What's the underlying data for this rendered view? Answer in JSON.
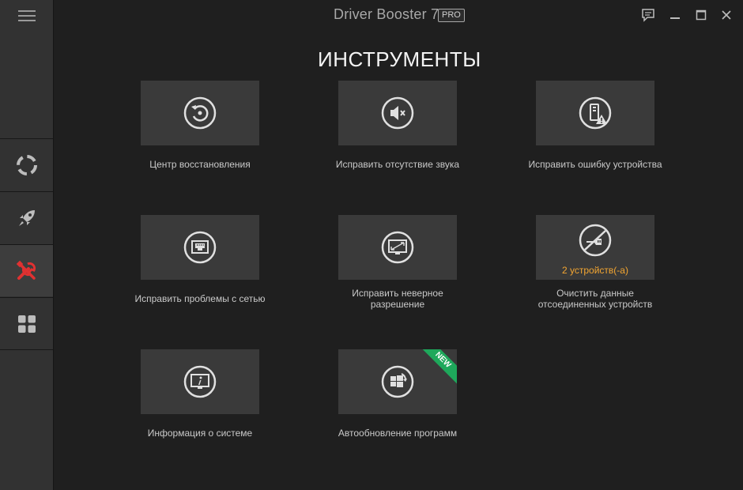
{
  "app": {
    "title": "Driver Booster 7",
    "edition_badge": "PRO"
  },
  "sidebar": {
    "menu_icon": "hamburger-icon",
    "items": [
      {
        "id": "scan",
        "icon": "lifebuoy-icon",
        "active": false
      },
      {
        "id": "boost",
        "icon": "rocket-icon",
        "active": false
      },
      {
        "id": "tools",
        "icon": "tools-icon",
        "active": true
      },
      {
        "id": "action-center",
        "icon": "grid-icon",
        "active": false
      }
    ]
  },
  "window_controls": [
    "feedback-icon",
    "minimize-icon",
    "maximize-icon",
    "close-icon"
  ],
  "page": {
    "title": "ИНСТРУМЕНТЫ"
  },
  "tools": [
    {
      "label": "Центр восстановления",
      "icon": "restore-icon"
    },
    {
      "label": "Исправить отсутствие звука",
      "icon": "mute-speaker-icon"
    },
    {
      "label": "Исправить ошибку устройства",
      "icon": "device-warning-icon"
    },
    {
      "label": "Исправить проблемы с сетью",
      "icon": "network-port-icon"
    },
    {
      "label_line1": "Исправить неверное",
      "label_line2": "разрешение",
      "icon": "resolution-icon"
    },
    {
      "label_line1": "Очистить данные",
      "label_line2": "отсоединенных устройств",
      "count": "2 устройств(-а)",
      "icon": "disconnected-device-icon"
    },
    {
      "label": "Информация о системе",
      "icon": "system-info-icon"
    },
    {
      "label": "Автообновление программ",
      "icon": "windows-update-icon",
      "badge": "NEW"
    }
  ],
  "colors": {
    "background": "#1f1f1f",
    "sidebar": "#323232",
    "tile": "#3a3a3a",
    "accent_red": "#e03131",
    "count_orange": "#f2a531",
    "new_badge": "#1ea85b"
  }
}
